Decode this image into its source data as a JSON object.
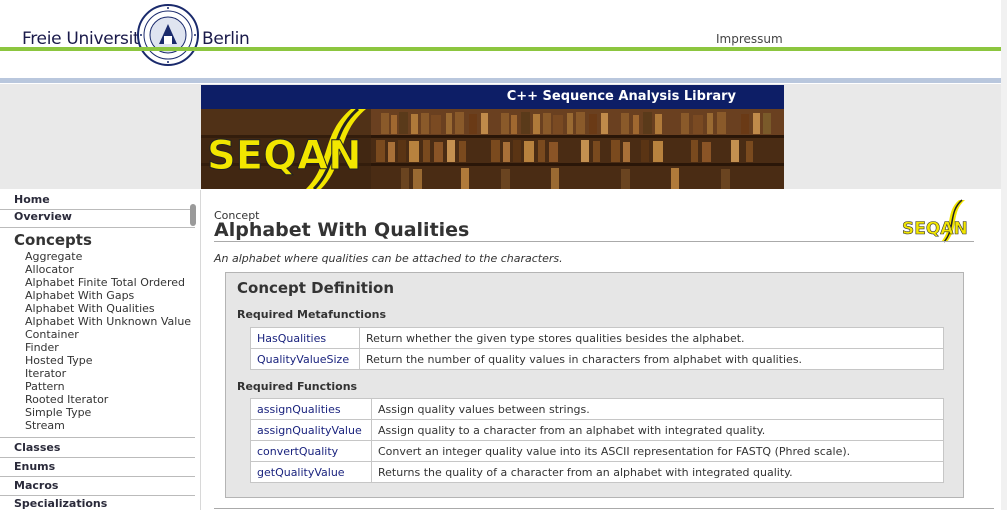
{
  "header": {
    "university_left": "Freie Universität",
    "university_right": "Berlin",
    "impressum": "Impressum"
  },
  "banner": {
    "title": "C++ Sequence Analysis Library",
    "logo_text": "SEQAN"
  },
  "sidebar": {
    "top_links": [
      "Home",
      "Overview"
    ],
    "concepts_heading": "Concepts",
    "concepts": [
      "Aggregate",
      "Allocator",
      "Alphabet Finite Total Ordered",
      "Alphabet With Gaps",
      "Alphabet With Qualities",
      "Alphabet With Unknown Value",
      "Container",
      "Finder",
      "Hosted Type",
      "Iterator",
      "Pattern",
      "Rooted Iterator",
      "Simple Type",
      "Stream"
    ],
    "bottom_links": [
      "Classes",
      "Enums",
      "Macros",
      "Specializations"
    ]
  },
  "main": {
    "kind_label": "Concept",
    "title": "Alphabet With Qualities",
    "summary": "An alphabet where qualities can be attached to the characters.",
    "definition": {
      "heading": "Concept Definition",
      "metafunctions_heading": "Required Metafunctions",
      "metafunctions": [
        {
          "name": "HasQualities",
          "desc": "Return whether the given type stores qualities besides the alphabet."
        },
        {
          "name": "QualityValueSize",
          "desc": "Return the number of quality values in characters from alphabet with qualities."
        }
      ],
      "functions_heading": "Required Functions",
      "functions": [
        {
          "name": "assignQualities",
          "desc": "Assign quality values between strings."
        },
        {
          "name": "assignQualityValue",
          "desc": "Assign quality to a character from an alphabet with integrated quality."
        },
        {
          "name": "convertQuality",
          "desc": "Convert an integer quality value into its ASCII representation for FASTQ (Phred scale)."
        },
        {
          "name": "getQualityValue",
          "desc": "Returns the quality of a character from an alphabet with integrated quality."
        }
      ]
    }
  },
  "colors": {
    "green_accent": "#8cc63f",
    "banner_blue": "#0d1e66",
    "link_blue": "#1a237e",
    "logo_yellow": "#f2e600"
  }
}
